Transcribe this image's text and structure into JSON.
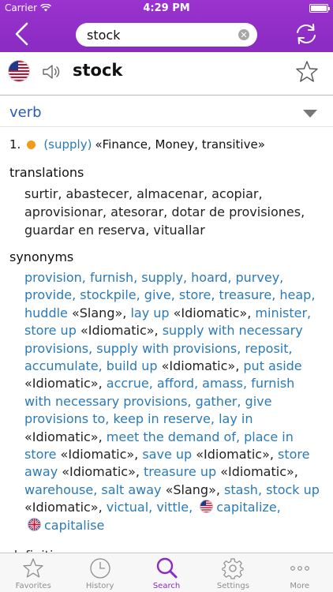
{
  "status": {
    "carrier": "Carrier",
    "time": "4:29 PM"
  },
  "nav": {
    "search_value": "stock"
  },
  "entry": {
    "headword": "stock",
    "pos": "verb",
    "sense_number": "1.",
    "sense_domain": "(supply)",
    "sense_labels": "«Finance, Money, transitive»",
    "translations_title": "translations",
    "translations": "surtir, abastecer, almacenar, acopiar, aprovisionar, atesorar, dotar de provisiones, guardar en reserva, vituallar",
    "synonyms_title": "synonyms",
    "synonyms": [
      {
        "t": "provision, furnish, supply, hoard, purvey, provide, stockpile, give, store, treasure, heap, huddle",
        "c": "syn"
      },
      {
        "t": " «Slang», ",
        "c": "note"
      },
      {
        "t": "lay up",
        "c": "syn"
      },
      {
        "t": " «Idiomatic», ",
        "c": "note"
      },
      {
        "t": "minister, store up",
        "c": "syn"
      },
      {
        "t": " «Idiomatic», ",
        "c": "note"
      },
      {
        "t": "supply with necessary provisions, supply with provisions, reposit, accumulate, build up",
        "c": "syn"
      },
      {
        "t": " «Idiomatic», ",
        "c": "note"
      },
      {
        "t": "put aside",
        "c": "syn"
      },
      {
        "t": " «Idiomatic», ",
        "c": "note"
      },
      {
        "t": "accrue, afford, amass, furnish with necessary provisions, gather, give provisions to, keep in reserve, lay in",
        "c": "syn"
      },
      {
        "t": " «Idiomatic», ",
        "c": "note"
      },
      {
        "t": "meet the demand of, place in store",
        "c": "syn"
      },
      {
        "t": " «Idiomatic», ",
        "c": "note"
      },
      {
        "t": "save up",
        "c": "syn"
      },
      {
        "t": " «Idiomatic», ",
        "c": "note"
      },
      {
        "t": "store away",
        "c": "syn"
      },
      {
        "t": " «Idiomatic», ",
        "c": "note"
      },
      {
        "t": "treasure up",
        "c": "syn"
      },
      {
        "t": " «Idiomatic», ",
        "c": "note"
      },
      {
        "t": "warehouse, salt away",
        "c": "syn"
      },
      {
        "t": " «Slang», ",
        "c": "note"
      },
      {
        "t": "stash, stock up",
        "c": "syn"
      },
      {
        "t": " «Idiomatic», ",
        "c": "note"
      },
      {
        "t": "victual, vittle,",
        "c": "syn"
      }
    ],
    "us_variant": "capitalize,",
    "uk_variant": "capitalise",
    "next_section_cut": "definitions"
  },
  "tabs": [
    {
      "label": "Favorites",
      "icon": "star-icon"
    },
    {
      "label": "History",
      "icon": "clock-icon"
    },
    {
      "label": "Search",
      "icon": "magnifier-icon"
    },
    {
      "label": "Settings",
      "icon": "gear-icon"
    },
    {
      "label": "More",
      "icon": "more-icon"
    }
  ],
  "colors": {
    "brand": "#8a2bc2",
    "link": "#2a7ab8",
    "pos": "#2a5db0",
    "dot": "#f39a16"
  }
}
